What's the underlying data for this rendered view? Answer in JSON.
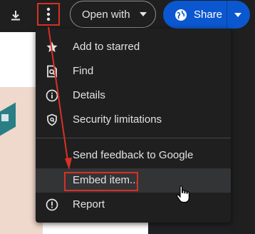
{
  "toolbar": {
    "download_icon": "download-icon",
    "more_icon": "more-vert-icon",
    "open_with_label": "Open with",
    "share_label": "Share",
    "share_icon": "globe-icon"
  },
  "menu": {
    "items": [
      {
        "label": "Add to starred",
        "icon": "star-icon"
      },
      {
        "label": "Find",
        "icon": "find-in-page-icon"
      },
      {
        "label": "Details",
        "icon": "info-icon"
      },
      {
        "label": "Security limitations",
        "icon": "shield-icon"
      },
      {
        "label": "Send feedback to Google",
        "icon": ""
      },
      {
        "label": "Embed item...",
        "icon": "",
        "highlighted": true
      },
      {
        "label": "Report",
        "icon": "report-icon"
      }
    ]
  },
  "colors": {
    "accent_red": "#d93025",
    "share_blue": "#0b57d0",
    "menu_bg": "#1f1f1f",
    "hover_bg": "#333436",
    "text": "#e3e3e3"
  }
}
